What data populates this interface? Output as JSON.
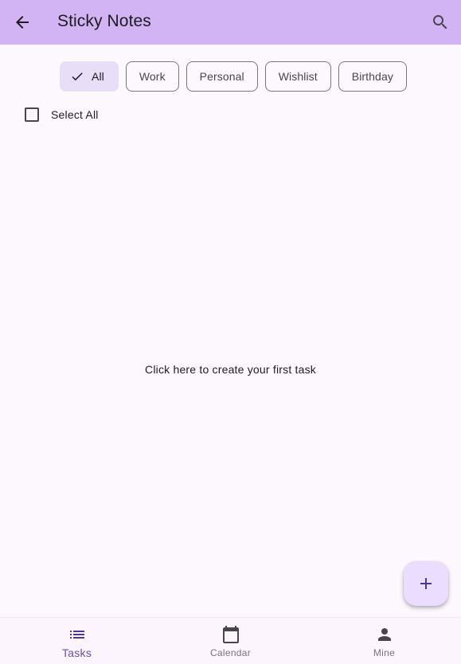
{
  "app": {
    "title": "Sticky Notes"
  },
  "header": {
    "back_icon": "arrow-back-icon",
    "search_icon": "search-icon"
  },
  "filters": [
    {
      "label": "All",
      "selected": true
    },
    {
      "label": "Work",
      "selected": false
    },
    {
      "label": "Personal",
      "selected": false
    },
    {
      "label": "Wishlist",
      "selected": false
    },
    {
      "label": "Birthday",
      "selected": false
    }
  ],
  "select_all": {
    "label": "Select All",
    "checked": false
  },
  "empty_state": {
    "text": "Click here to create your first task"
  },
  "fab": {
    "icon": "add-icon"
  },
  "bottom_nav": {
    "items": [
      {
        "label": "Tasks",
        "icon": "list-icon",
        "active": true
      },
      {
        "label": "Calendar",
        "icon": "calendar-icon",
        "active": false
      },
      {
        "label": "Mine",
        "icon": "person-icon",
        "active": false
      }
    ]
  },
  "colors": {
    "app_bar": "#d2b3f3",
    "background": "#fdf7fe",
    "selected_chip": "#e8def8",
    "fab": "#eaddff",
    "active_nav": "#6750a4"
  }
}
